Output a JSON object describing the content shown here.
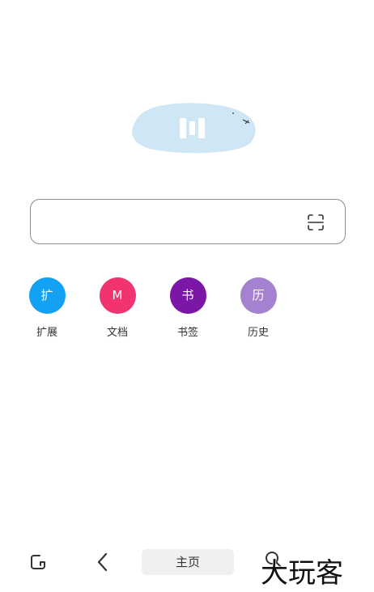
{
  "search": {
    "value": "",
    "placeholder": ""
  },
  "shortcuts": [
    {
      "icon_text": "扩",
      "label": "扩展",
      "color": "#13a2f3"
    },
    {
      "icon_text": "M",
      "label": "文档",
      "color": "#f1336f"
    },
    {
      "icon_text": "书",
      "label": "书签",
      "color": "#7b16a7"
    },
    {
      "icon_text": "历",
      "label": "历史",
      "color": "#a582cf"
    }
  ],
  "bottom_bar": {
    "home_label": "主页"
  },
  "watermark": {
    "text": "大玩客"
  },
  "colors": {
    "logo_blob": "#cfe6f4",
    "border": "#8d8d8d"
  }
}
